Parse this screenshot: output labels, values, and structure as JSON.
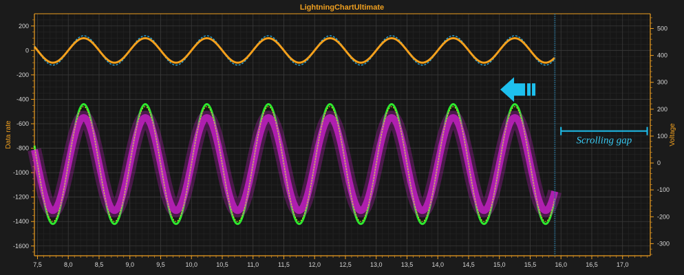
{
  "chart_data": {
    "type": "line",
    "title": "LightningChartUltimate",
    "xlabel": "",
    "ylabel": "Data rate",
    "y2label": "Voltage",
    "x_ticks": [
      "7,5",
      "8,0",
      "8,5",
      "9,0",
      "9,5",
      "10,0",
      "10,5",
      "11,0",
      "11,5",
      "12,0",
      "12,5",
      "13,0",
      "13,5",
      "14,0",
      "14,5",
      "15,0",
      "15,5",
      "16,0",
      "16,5",
      "17,0"
    ],
    "y_ticks": [
      "200",
      "0",
      "-200",
      "-400",
      "-600",
      "-800",
      "-1000",
      "-1200",
      "-1400",
      "-1600"
    ],
    "y2_ticks": [
      "500",
      "400",
      "300",
      "200",
      "100",
      "0",
      "-100",
      "-200",
      "-300"
    ],
    "xlim": [
      7.45,
      17.45
    ],
    "ylim": [
      -1680,
      300
    ],
    "y2lim": [
      -345,
      555
    ],
    "grid": true,
    "annotation": "Scrolling gap",
    "scroll_position": 15.9,
    "series": [
      {
        "axis": "y1",
        "amplitude": 120,
        "offset": 0,
        "style": "dashed",
        "color": "#2aa6d8"
      },
      {
        "axis": "y1",
        "amplitude": 100,
        "offset": 0,
        "style": "solid",
        "color": "#f4a01c"
      },
      {
        "axis": "y1",
        "amplitude": 490,
        "offset": -930,
        "style": "solid",
        "color": "#2ee82e"
      },
      {
        "axis": "y1",
        "amplitude": 380,
        "offset": -930,
        "style": "band",
        "color": "#d020d0"
      },
      {
        "axis": "y1",
        "amplitude": 470,
        "offset": -930,
        "style": "thin",
        "color": "#e8e020"
      }
    ],
    "period": 1.0,
    "x_start": 7.45,
    "x_end": 15.9
  }
}
